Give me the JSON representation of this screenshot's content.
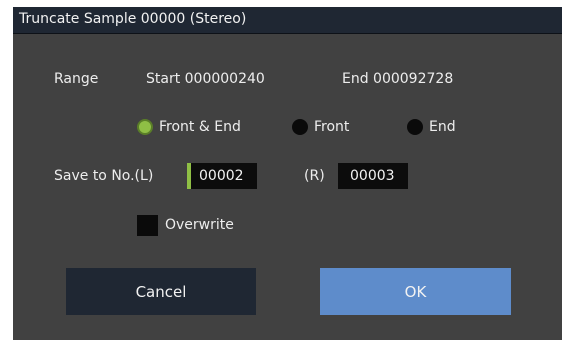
{
  "dialog": {
    "title": "Truncate Sample 00000 (Stereo)"
  },
  "range": {
    "label": "Range",
    "start_text": "Start 000000240",
    "end_text": "End 000092728"
  },
  "truncate_mode": {
    "options": [
      "Front & End",
      "Front",
      "End"
    ],
    "selected": "Front & End"
  },
  "save_to": {
    "label": "Save to No.(L)",
    "left_value": "00002",
    "right_label": "(R)",
    "right_value": "00003"
  },
  "overwrite": {
    "label": "Overwrite",
    "checked": false
  },
  "buttons": {
    "cancel": "Cancel",
    "ok": "OK"
  },
  "colors": {
    "dialog_bg": "#414141",
    "title_bar": "#1f2733",
    "accent_green": "#8fbf45",
    "ok_blue": "#5e8ccb"
  }
}
